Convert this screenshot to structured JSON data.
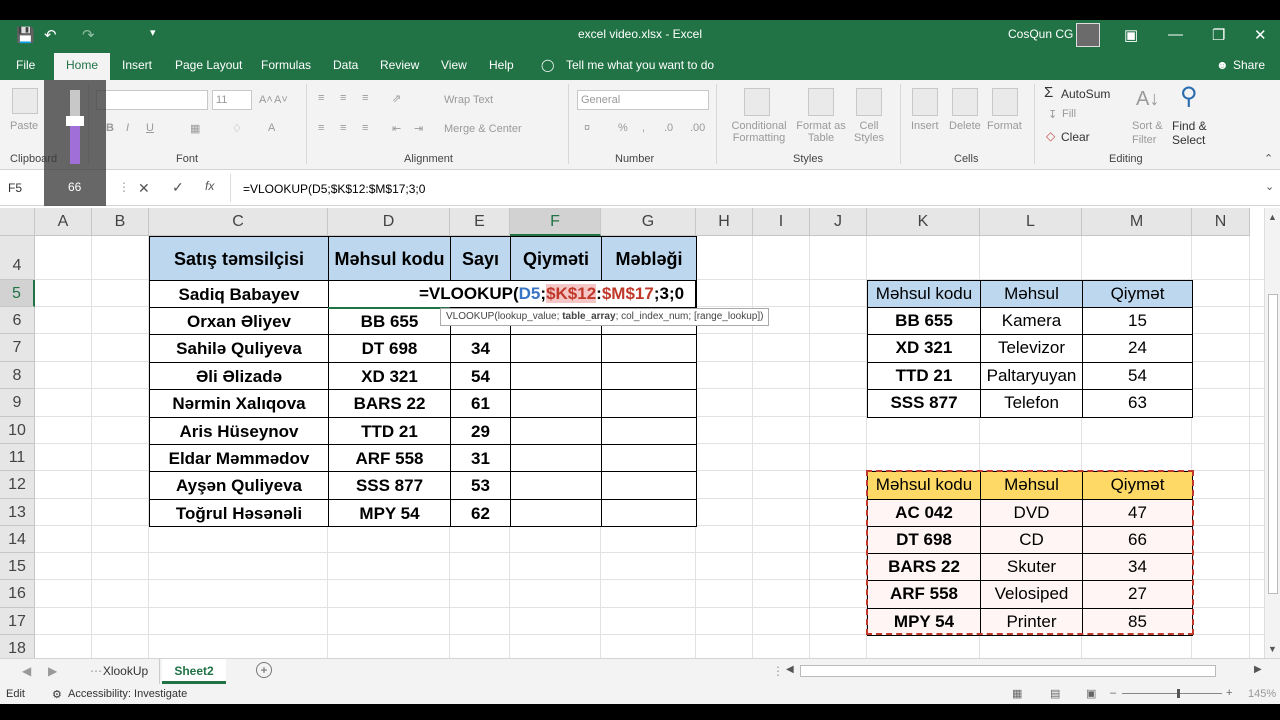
{
  "window": {
    "title": "excel video.xlsx - Excel",
    "user": "CosQun CG"
  },
  "menu": [
    "File",
    "Home",
    "Insert",
    "Page Layout",
    "Formulas",
    "Data",
    "Review",
    "View",
    "Help"
  ],
  "tell_me": "Tell me what you want to do",
  "share": "Share",
  "ribbon": {
    "paste": "Paste",
    "font_size": "11",
    "wrap_text": "Wrap Text",
    "merge_center": "Merge & Center",
    "number_format": "General",
    "conditional": [
      "Conditional",
      "Formatting"
    ],
    "format_as": [
      "Format as",
      "Table"
    ],
    "cell_styles": [
      "Cell",
      "Styles"
    ],
    "insert": "Insert",
    "delete": "Delete",
    "format": "Format",
    "autosum": "AutoSum",
    "fill": "Fill",
    "clear": "Clear",
    "sort_filter": [
      "Sort &",
      "Filter"
    ],
    "find_select": [
      "Find &",
      "Select"
    ],
    "groups": {
      "clipboard": "Clipboard",
      "font": "Font",
      "alignment": "Alignment",
      "number": "Number",
      "styles": "Styles",
      "cells": "Cells",
      "editing": "Editing"
    }
  },
  "zoom_overlay_value": "66",
  "formula_bar": {
    "name_box": "F5",
    "formula": "=VLOOKUP(D5;$K$12:$M$17;3;0"
  },
  "columns": [
    "A",
    "B",
    "C",
    "D",
    "E",
    "F",
    "G",
    "H",
    "I",
    "J",
    "K",
    "L",
    "M",
    "N"
  ],
  "rows": [
    "4",
    "5",
    "6",
    "7",
    "8",
    "9",
    "10",
    "11",
    "12",
    "13",
    "14",
    "15",
    "16",
    "17",
    "18"
  ],
  "main_table": {
    "headers": [
      "Satış təmsilçisi",
      "Məhsul kodu",
      "Sayı",
      "Qiyməti",
      "Məbləği"
    ],
    "rows": [
      [
        "Sadiq Babayev",
        "",
        "",
        "",
        ""
      ],
      [
        "Orxan Əliyev",
        "BB 655",
        "",
        "",
        ""
      ],
      [
        "Sahilə Quliyeva",
        "DT 698",
        "34",
        "",
        ""
      ],
      [
        "Əli Əlizadə",
        "XD 321",
        "54",
        "",
        ""
      ],
      [
        "Nərmin Xalıqova",
        "BARS 22",
        "61",
        "",
        ""
      ],
      [
        "Aris Hüseynov",
        "TTD 21",
        "29",
        "",
        ""
      ],
      [
        "Eldar Məmmədov",
        "ARF 558",
        "31",
        "",
        ""
      ],
      [
        "Ayşən Quliyeva",
        "SSS 877",
        "53",
        "",
        ""
      ],
      [
        "Toğrul Həsənəli",
        "MPY 54",
        "62",
        "",
        ""
      ]
    ]
  },
  "editing_formula": {
    "prefix": "=VLOOKUP(",
    "ref1": "D5",
    "sep1": ";",
    "ref2a": "$K$12",
    "colon": ":",
    "ref2b": "$M$17",
    "rest": ";3;0"
  },
  "tooltip": {
    "fn": "VLOOKUP(",
    "a1": "lookup_value",
    "a2": "table_array",
    "a3": "col_index_num",
    "a4": "[range_lookup]",
    "end": ")"
  },
  "lookup_table_1": {
    "headers": [
      "Məhsul kodu",
      "Məhsul",
      "Qiymət"
    ],
    "rows": [
      [
        "BB 655",
        "Kamera",
        "15"
      ],
      [
        "XD 321",
        "Televizor",
        "24"
      ],
      [
        "TTD 21",
        "Paltaryuyan",
        "54"
      ],
      [
        "SSS 877",
        "Telefon",
        "63"
      ]
    ]
  },
  "lookup_table_2": {
    "headers": [
      "Məhsul kodu",
      "Məhsul",
      "Qiymət"
    ],
    "rows": [
      [
        "AC 042",
        "DVD",
        "47"
      ],
      [
        "DT 698",
        "CD",
        "66"
      ],
      [
        "BARS 22",
        "Skuter",
        "34"
      ],
      [
        "ARF 558",
        "Velosiped",
        "27"
      ],
      [
        "MPY 54",
        "Printer",
        "85"
      ]
    ]
  },
  "sheets": [
    "XlookUp",
    "Sheet2"
  ],
  "active_sheet": "Sheet2",
  "status": {
    "mode": "Edit",
    "accessibility": "Accessibility: Investigate",
    "zoom": "145%"
  }
}
